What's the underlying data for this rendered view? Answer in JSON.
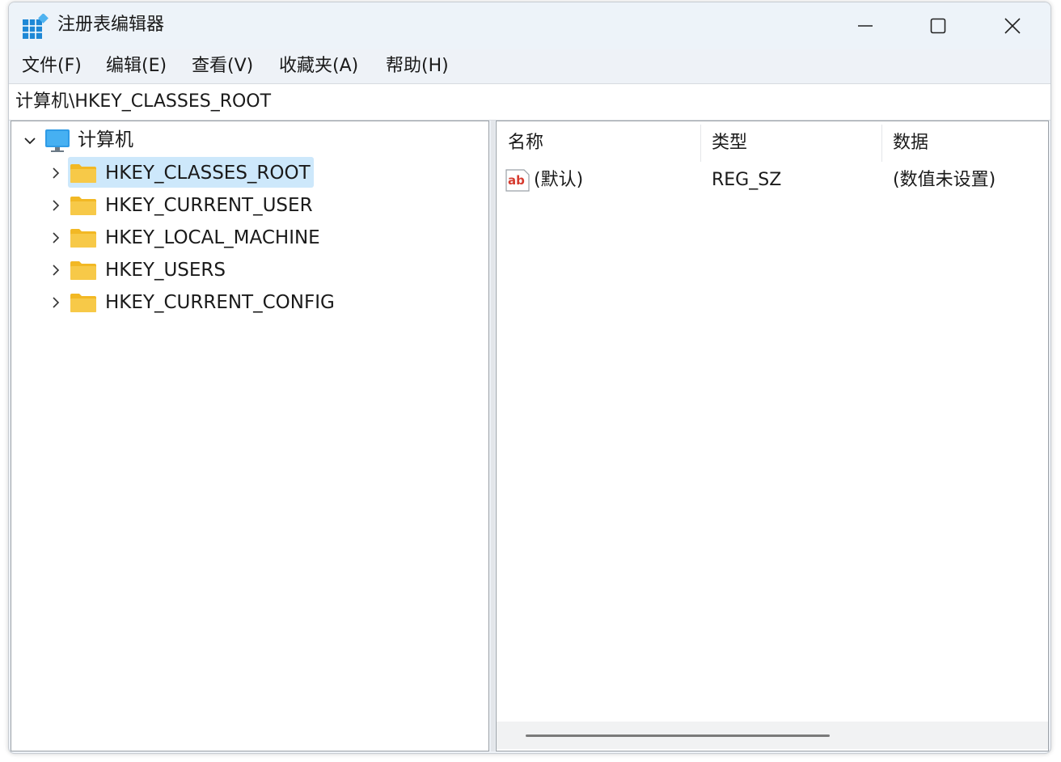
{
  "window": {
    "title": "注册表编辑器",
    "minimize_icon": "minimize-icon",
    "maximize_icon": "maximize-icon",
    "close_icon": "close-icon"
  },
  "menu": {
    "items": [
      "文件(F)",
      "编辑(E)",
      "查看(V)",
      "收藏夹(A)",
      "帮助(H)"
    ]
  },
  "address": {
    "path": "计算机\\HKEY_CLASSES_ROOT"
  },
  "tree": {
    "root_label": "计算机",
    "children": [
      "HKEY_CLASSES_ROOT",
      "HKEY_CURRENT_USER",
      "HKEY_LOCAL_MACHINE",
      "HKEY_USERS",
      "HKEY_CURRENT_CONFIG"
    ],
    "selected_index": 0
  },
  "list": {
    "columns": [
      "名称",
      "类型",
      "数据"
    ],
    "rows": [
      {
        "name": "(默认)",
        "type": "REG_SZ",
        "data": "(数值未设置)",
        "icon": "string-value-icon"
      }
    ]
  },
  "colors": {
    "selection": "#cde8fb",
    "folder": "#f7c948",
    "accent": "#1e88d6"
  }
}
